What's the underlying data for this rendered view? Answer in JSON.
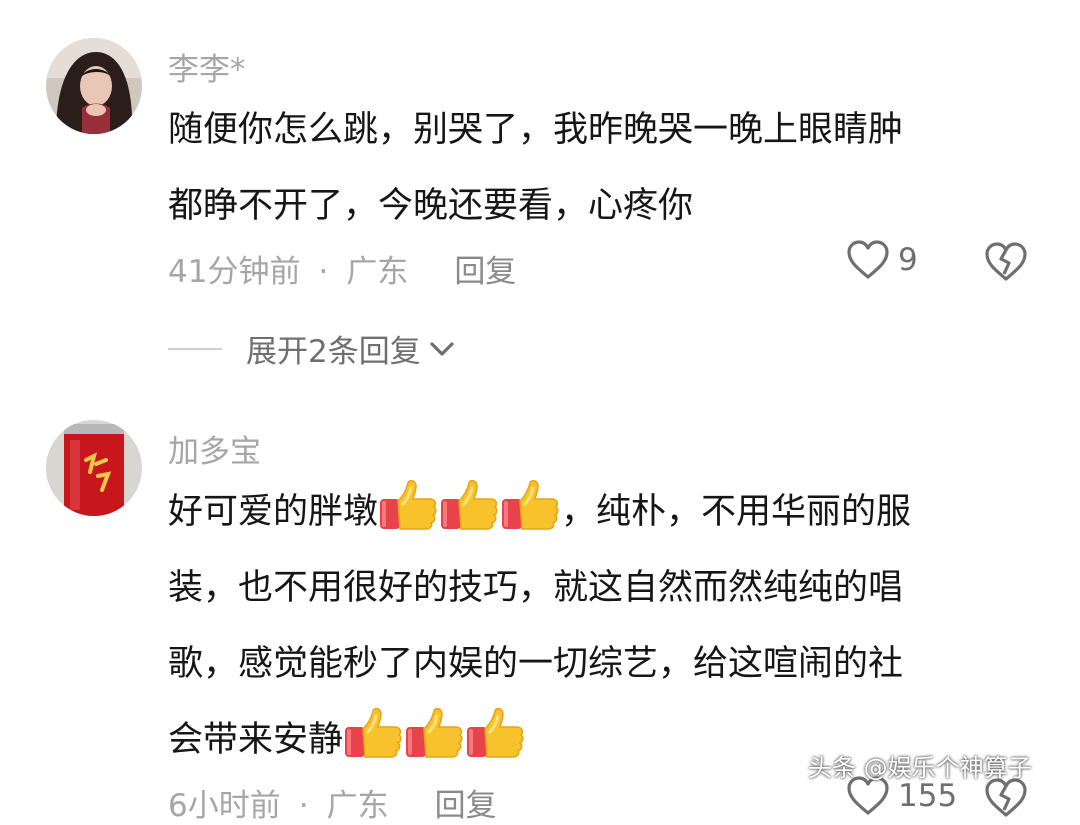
{
  "comments": [
    {
      "username": "李李*",
      "lines": [
        "随便你怎么跳，别哭了，我昨晚哭一晚上眼睛肿",
        "都睁不开了，今晚还要看，心疼你"
      ],
      "time": "41分钟前",
      "location": "广东",
      "reply_label": "回复",
      "likes": "9",
      "expand_label": "展开2条回复"
    },
    {
      "username": "加多宝",
      "line1_before": "好可爱的胖墩",
      "line1_after": "，纯朴，不用华丽的服",
      "lines": [
        "装，也不用很好的技巧，就这自然而然纯纯的唱",
        "歌，感觉能秒了内娱的一切综艺，给这喧闹的社"
      ],
      "line4_before": "会带来安静",
      "time": "6小时前",
      "location": "广东",
      "reply_label": "回复",
      "likes": "155"
    }
  ],
  "separator": "·",
  "watermark": "头条 @娱乐个神算子",
  "icons": {
    "like": "heart-outline-icon",
    "dislike": "broken-heart-icon",
    "expand": "chevron-down-icon",
    "emoji": "thumbs-up-emoji"
  },
  "colors": {
    "text": "#161616",
    "muted": "#a6a6a6",
    "action": "#6f6f6f"
  }
}
